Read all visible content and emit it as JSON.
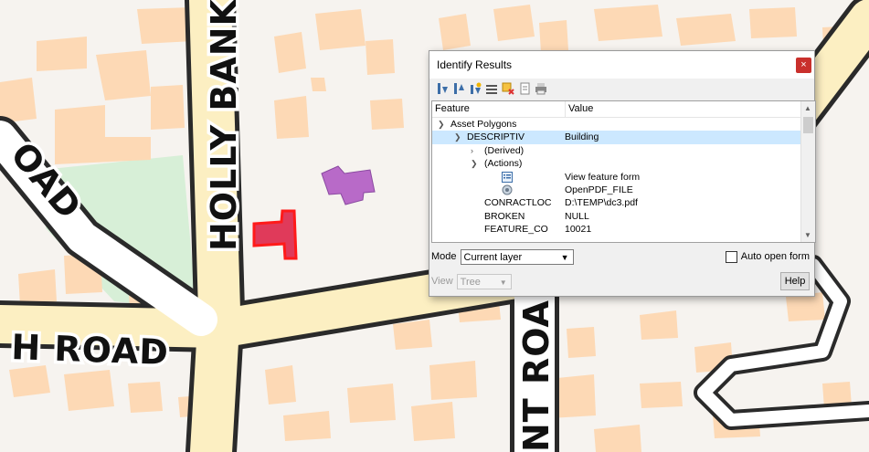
{
  "map": {
    "road_labels": [
      "HOLLY BANK",
      "OAD",
      "H ROAD",
      "NT ROAD"
    ],
    "colors": {
      "background": "#f6f3ef",
      "building": "#fdd9b5",
      "road_fill": "#fcefc2",
      "road_casing": "#2a2a2a",
      "green": "#d7efd7",
      "selected": "#e03a5a",
      "highlight": "#b86ac8"
    }
  },
  "dialog": {
    "title": "Identify Results",
    "close_icon": "×",
    "toolbar_icons": [
      "expand-all-icon",
      "collapse-all-icon",
      "expand-new-icon",
      "clear-results-icon",
      "copy-feature-icon",
      "copy-attributes-icon",
      "print-icon"
    ],
    "tree": {
      "headers": {
        "feature": "Feature",
        "value": "Value"
      },
      "rows": [
        {
          "feature": "Asset Polygons",
          "value": ""
        },
        {
          "feature": "DESCRIPTIV",
          "value": "Building"
        },
        {
          "feature": "(Derived)",
          "value": ""
        },
        {
          "feature": "(Actions)",
          "value": ""
        },
        {
          "feature": "",
          "value": "View feature form"
        },
        {
          "feature": "",
          "value": "OpenPDF_FILE"
        },
        {
          "feature": "CONRACTLOC",
          "value": "D:\\TEMP\\dc3.pdf"
        },
        {
          "feature": "BROKEN",
          "value": "NULL"
        },
        {
          "feature": "FEATURE_CO",
          "value": "10021"
        }
      ]
    },
    "mode": {
      "label": "Mode",
      "value": "Current layer"
    },
    "auto_open": {
      "label": "Auto open form",
      "checked": false
    },
    "view": {
      "label": "View",
      "value": "Tree"
    },
    "help_label": "Help"
  }
}
